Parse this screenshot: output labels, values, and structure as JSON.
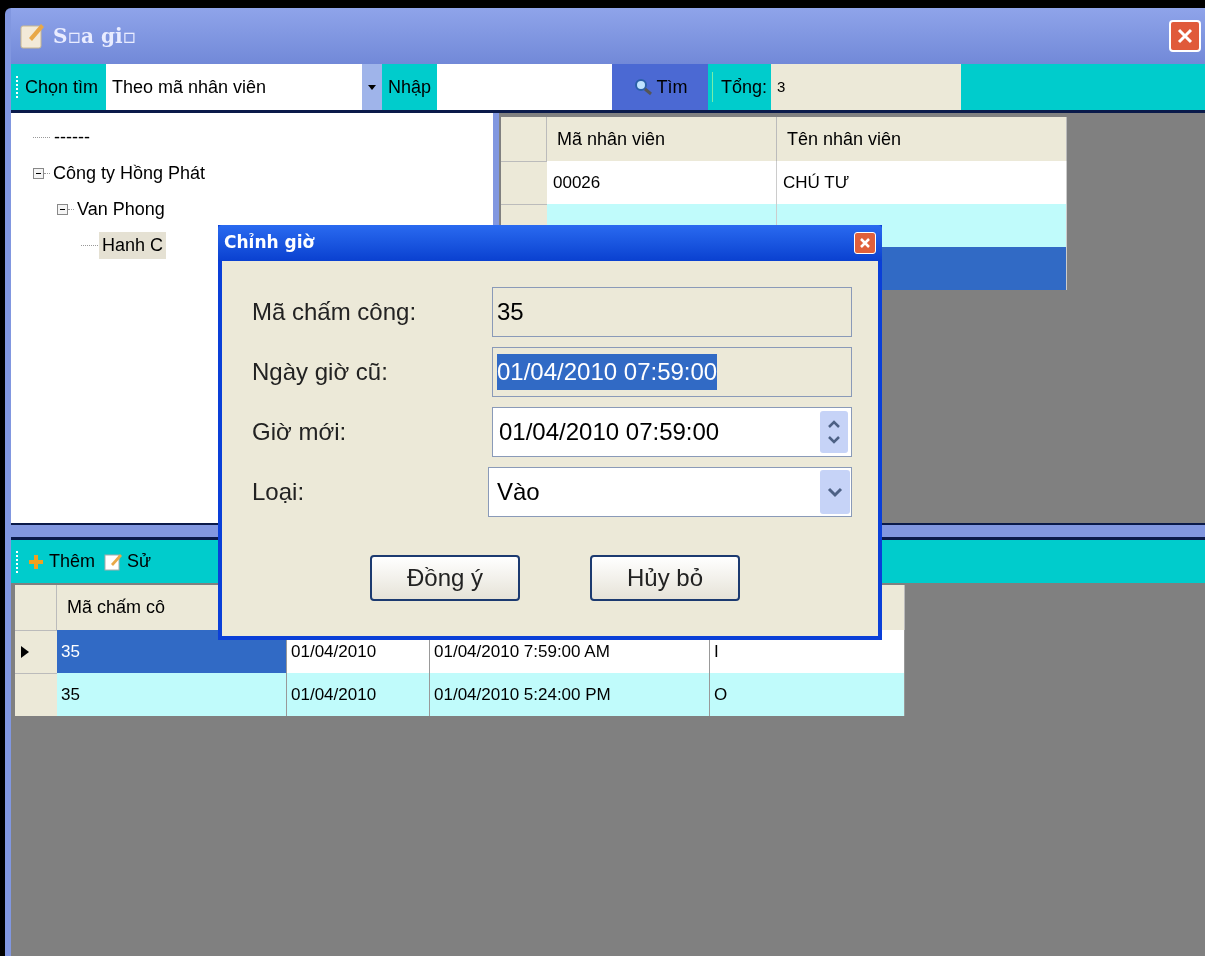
{
  "window": {
    "title": "S▫a gi▫"
  },
  "toolbar": {
    "search_by_label": "Chọn tìm",
    "search_by": "Theo mã nhân viên",
    "input_label": "Nhập",
    "search_button": "Tìm",
    "total_label": "Tổng:",
    "total": "3"
  },
  "tree": [
    {
      "label": "------",
      "selected": false
    },
    {
      "label": "Công ty Hồng Phát",
      "selected": false,
      "expanded": true,
      "children": [
        {
          "label": "Van Phong",
          "selected": false,
          "expanded": true,
          "children": [
            {
              "label": "Hanh C",
              "selected": true
            }
          ]
        }
      ]
    }
  ],
  "employees": {
    "columns": [
      "Mã nhân viên",
      "Tên nhân viên"
    ],
    "rows": [
      {
        "cells": [
          "00026",
          "CHÚ TƯ"
        ],
        "selected": false
      },
      {
        "selected": false
      },
      {
        "selected": true
      }
    ]
  },
  "bottom_toolbar": {
    "buttons": [
      {
        "label": "Thêm",
        "kind": "add"
      },
      {
        "label": "Sử",
        "kind": "edit"
      }
    ]
  },
  "records": {
    "columns": [
      "Mã chấm cô"
    ],
    "rows": [
      {
        "cells": [
          "35",
          "01/04/2010",
          "01/04/2010 7:59:00 AM",
          "I"
        ],
        "selected": true
      },
      {
        "cells": [
          "35",
          "01/04/2010",
          "01/04/2010 5:24:00 PM",
          "O"
        ],
        "selected": false
      }
    ]
  },
  "dialog": {
    "title": "Chỉnh giờ",
    "fields": [
      {
        "label": "Mã chấm công:",
        "value": "35",
        "kind": "readonly",
        "text_selected": false
      },
      {
        "label": "Ngày giờ cũ:",
        "value": "01/04/2010 07:59:00",
        "kind": "readonly",
        "text_selected": true
      },
      {
        "label": "Giờ mới:",
        "value": "01/04/2010 07:59:00",
        "kind": "spinner",
        "text_selected": false
      },
      {
        "label": "Loại:",
        "value": "Vào",
        "kind": "dropdown",
        "text_selected": false
      }
    ],
    "buttons": [
      "Đồng ý",
      "Hủy bỏ"
    ]
  }
}
